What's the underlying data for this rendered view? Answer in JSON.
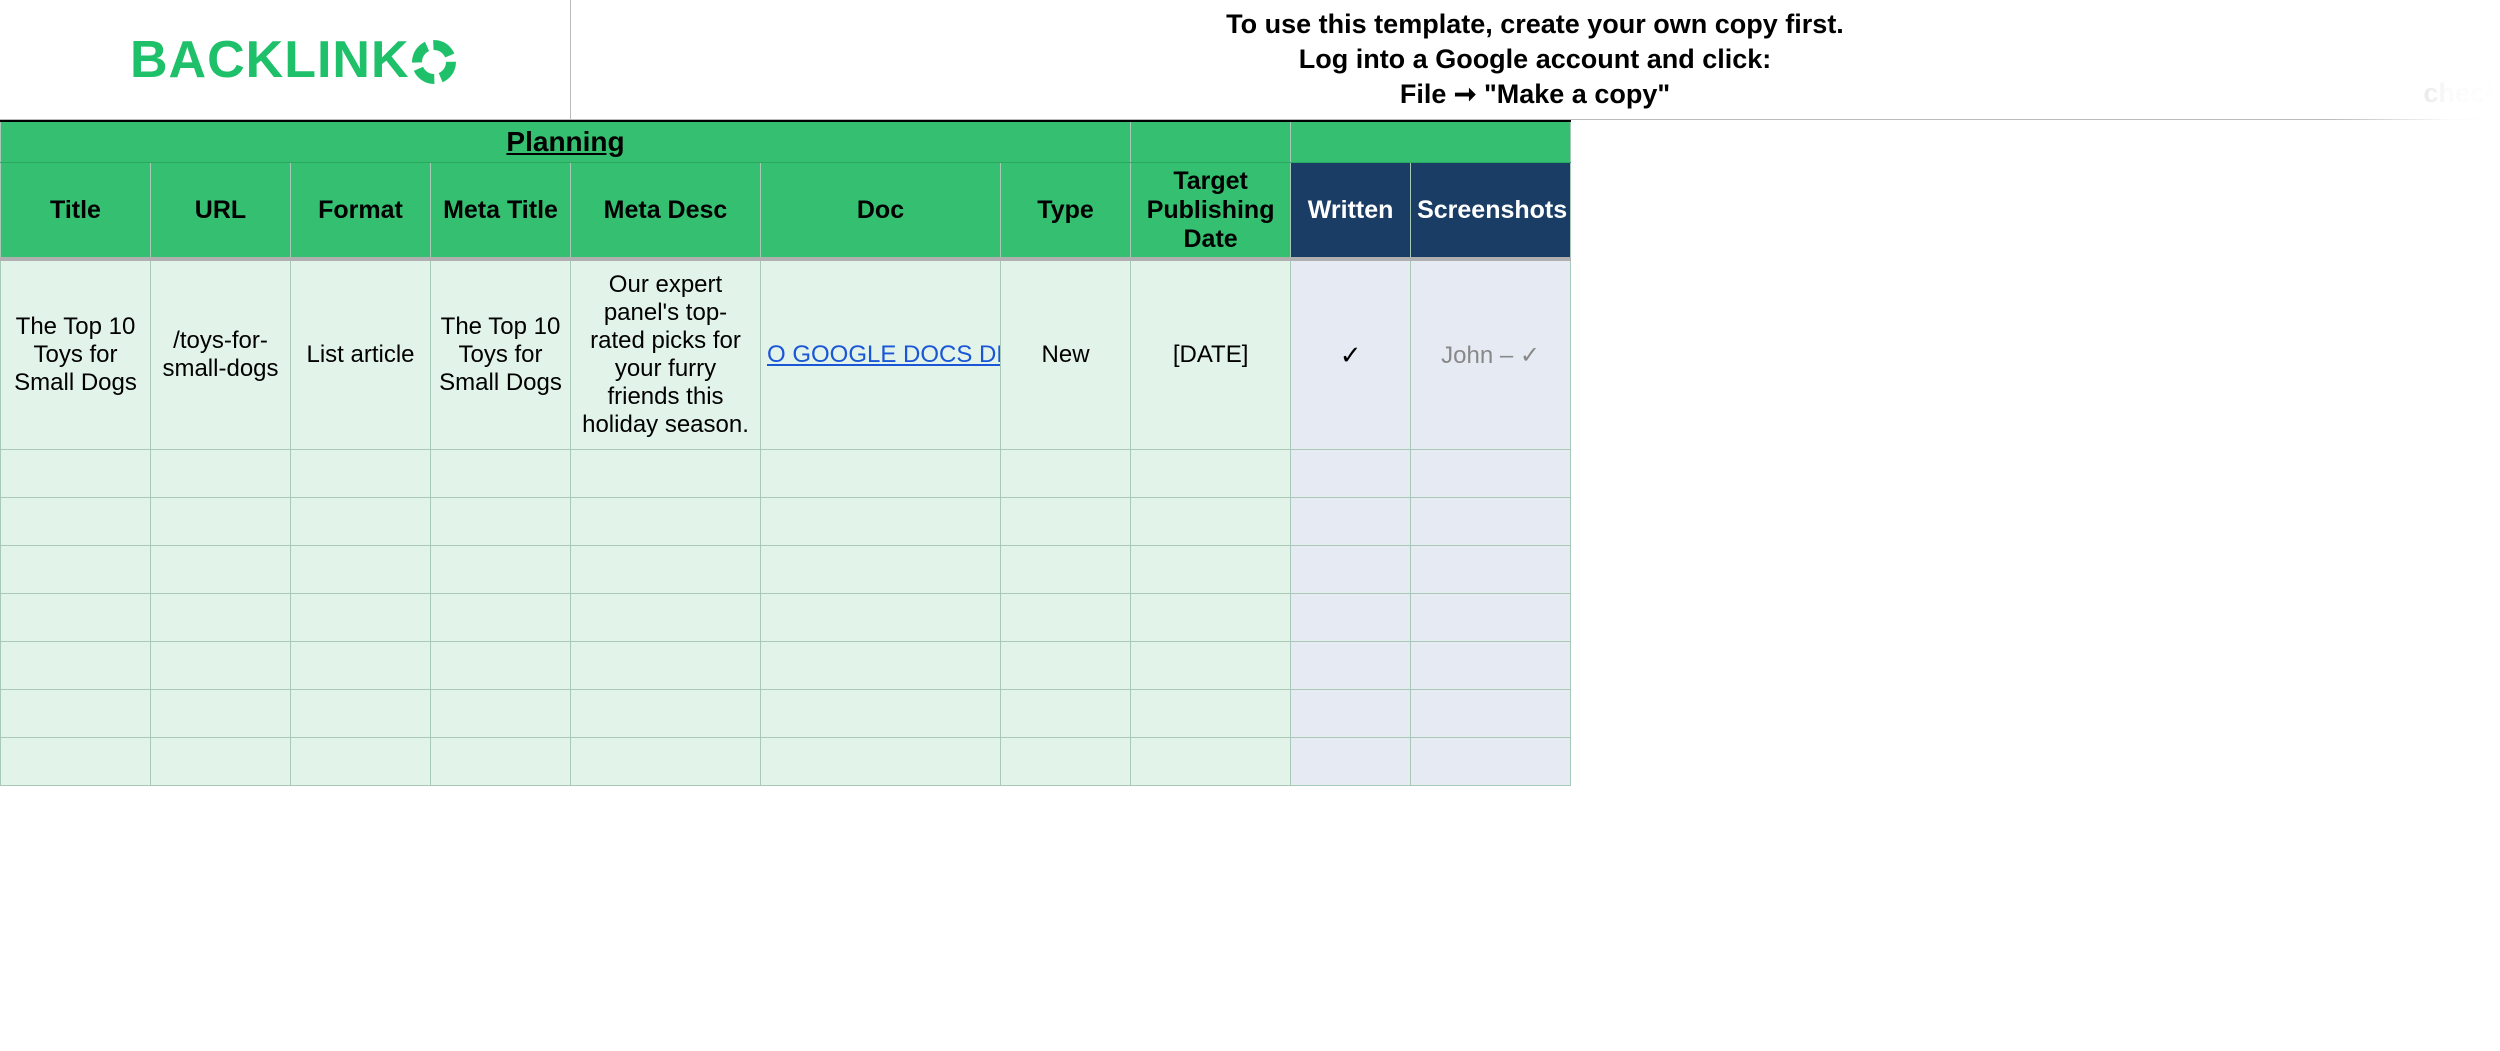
{
  "logo_text": "BACKLINK",
  "instructions": {
    "line1": "To use this template, create your own copy first.",
    "line2": "Log into a Google account and click:",
    "line3": "File ➞ \"Make a copy\""
  },
  "check_word": "check",
  "sections": {
    "planning": "Planning"
  },
  "headers": {
    "title": "Title",
    "url": "URL",
    "format": "Format",
    "meta_title": "Meta Title",
    "meta_desc": "Meta Desc",
    "doc": "Doc",
    "type": "Type",
    "target_date": "Target Publishing Date",
    "written": "Written",
    "screenshots": "Screenshots"
  },
  "row": {
    "title": "The Top 10 Toys for Small Dogs",
    "url": "/toys-for-small-dogs",
    "format": "List article",
    "meta_title": "The Top 10 Toys for Small Dogs",
    "meta_desc": "Our expert panel's top-rated picks for your furry friends this holiday season.",
    "doc": "O GOOGLE DOCS DRAFT",
    "type": "New",
    "target_date": "[DATE]",
    "written": "✓",
    "screenshots": "John – ✓"
  }
}
